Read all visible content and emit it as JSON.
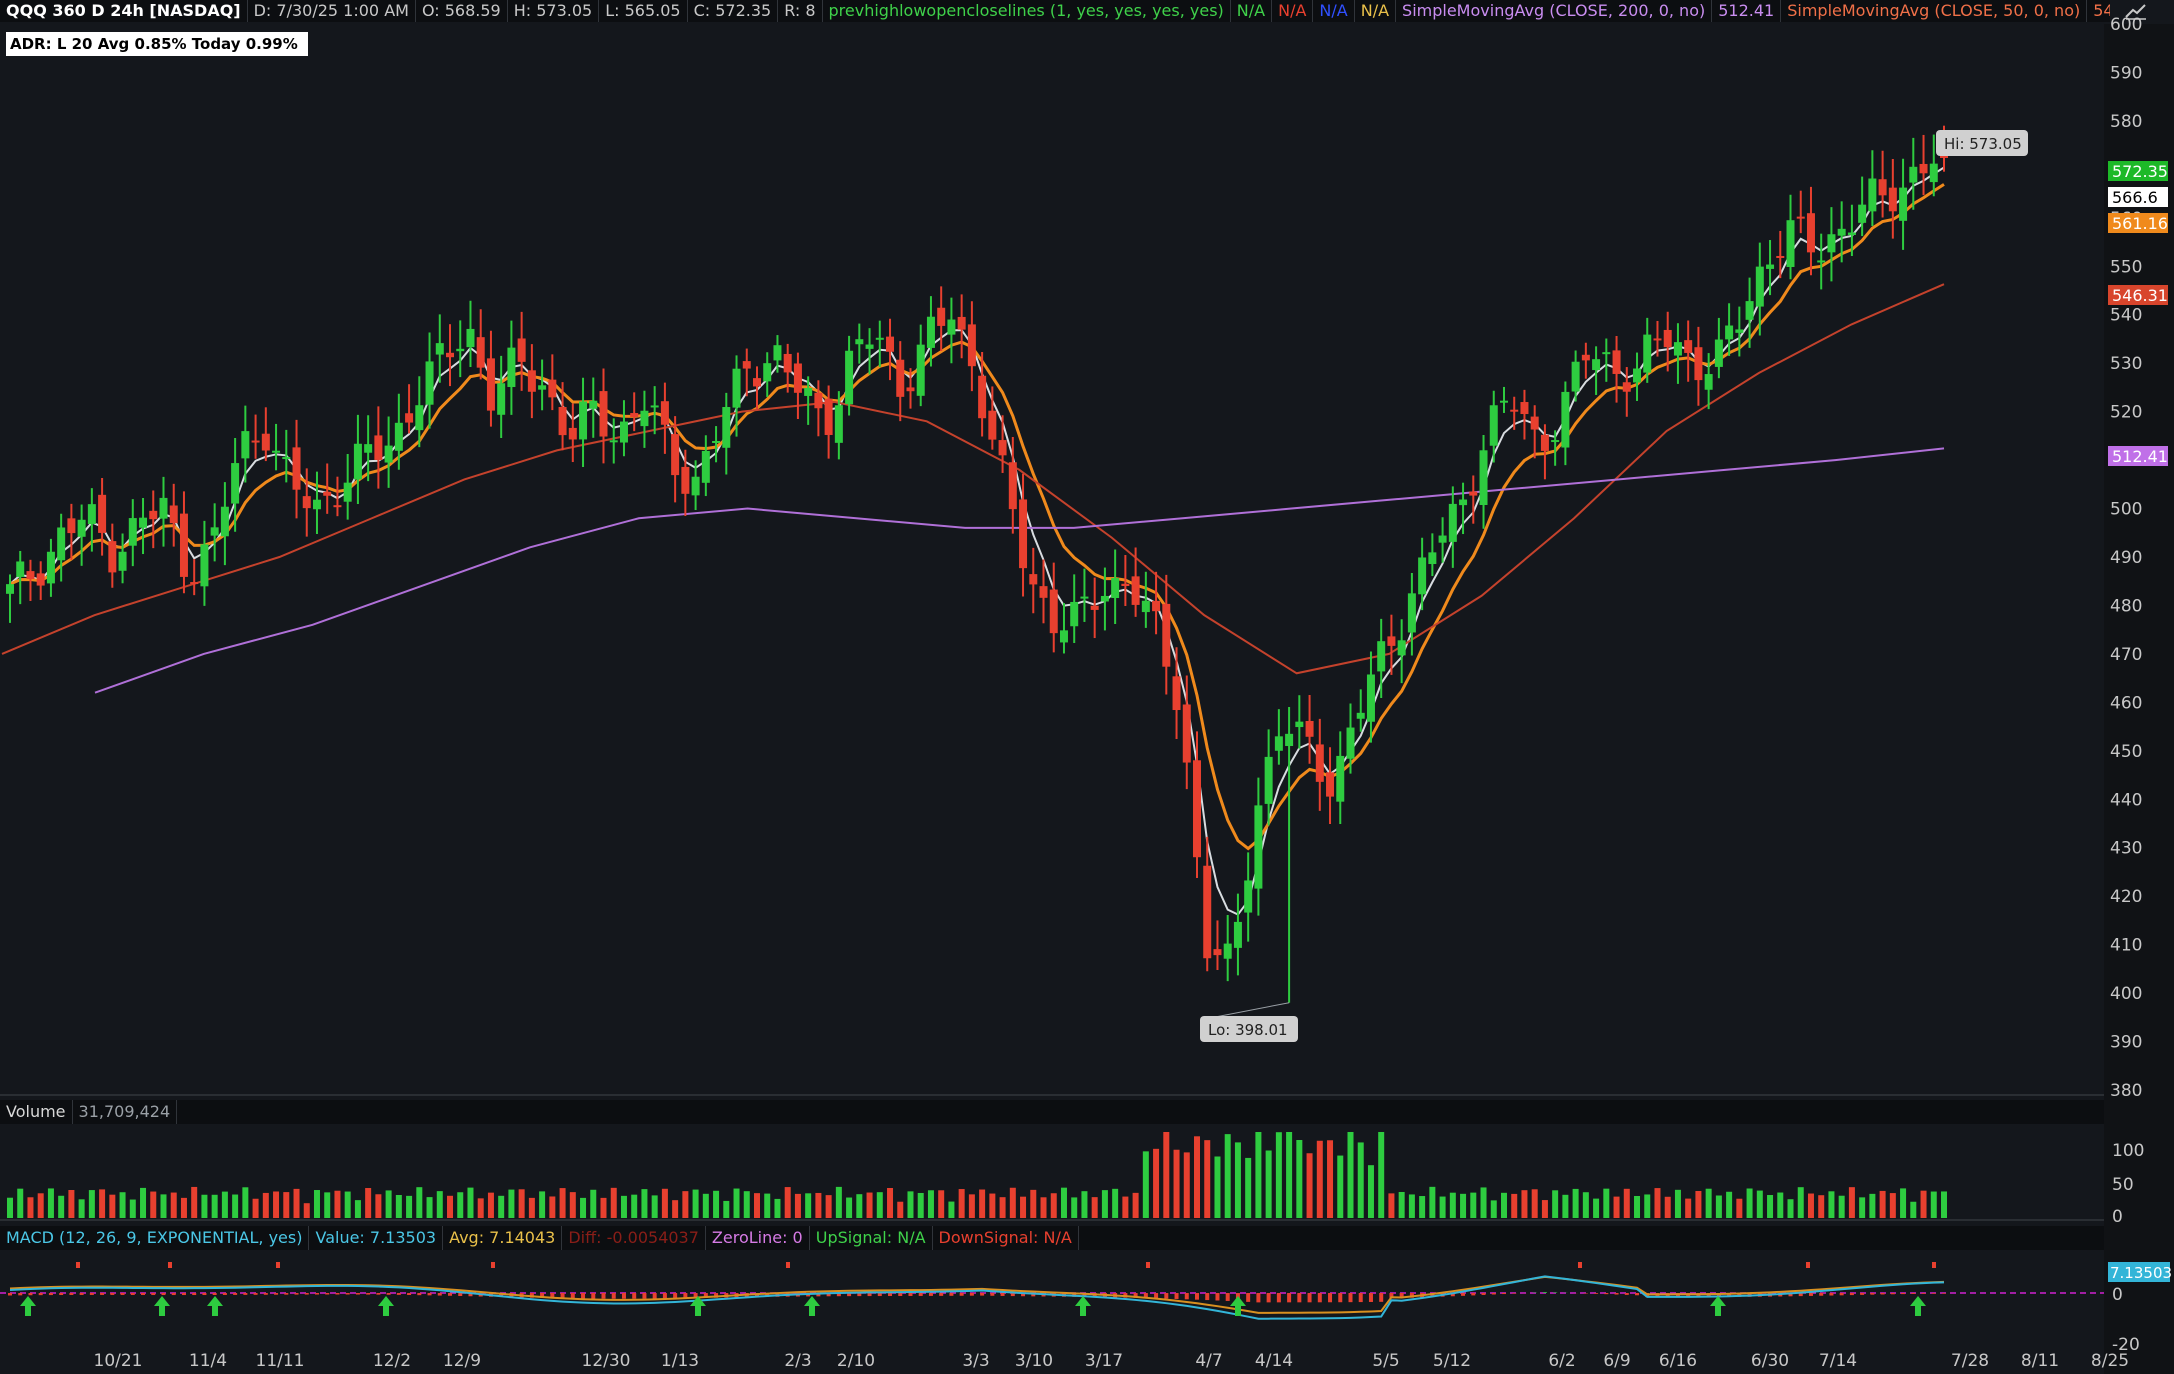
{
  "header": {
    "symbol": "QQQ 360 D 24h [NASDAQ]",
    "date": "D: 7/30/25 1:00 AM",
    "open": "O: 568.59",
    "high": "H: 573.05",
    "low": "L: 565.05",
    "close": "C: 572.35",
    "range": "R: 8",
    "study1": "prevhighlowopencloselines (1, yes, yes, yes, yes)",
    "study1_v1": "N/A",
    "study1_v2": "N/A",
    "study1_v3": "N/A",
    "study1_v4": "N/A",
    "sma200_label": "SimpleMovingAvg (CLOSE, 200, 0, no)",
    "sma200_value": "512.41",
    "sma50_label": "SimpleMovingAvg (CLOSE, 50, 0, no)",
    "sma50_value": "546.31",
    "more": "..."
  },
  "adr_label": "ADR: L 20  Avg 0.85%  Today 0.99%",
  "volume_header": {
    "label": "Volume",
    "value": "31,709,424"
  },
  "macd_header": {
    "label": "MACD (12, 26, 9, EXPONENTIAL, yes)",
    "value": "Value: 7.13503",
    "avg": "Avg: 7.14043",
    "diff": "Diff: -0.0054037",
    "zero": "ZeroLine: 0",
    "up": "UpSignal: N/A",
    "down": "DownSignal: N/A"
  },
  "chart_data": {
    "type": "candlestick",
    "price_axis": {
      "min": 380,
      "max": 600,
      "ticks": [
        380,
        390,
        400,
        410,
        420,
        430,
        440,
        450,
        460,
        470,
        480,
        490,
        500,
        510,
        520,
        530,
        540,
        550,
        560,
        570,
        580,
        590,
        600
      ]
    },
    "volume_axis": {
      "ticks": [
        "0",
        "50",
        "100"
      ]
    },
    "macd_axis": {
      "ticks": [
        "0",
        "-20"
      ]
    },
    "x_tick_labels": [
      "10/21",
      "11/4",
      "11/11",
      "12/2",
      "12/9",
      "12/30",
      "1/13",
      "2/3",
      "2/10",
      "3/3",
      "3/10",
      "3/17",
      "4/7",
      "4/14",
      "5/5",
      "5/12",
      "6/2",
      "6/9",
      "6/16",
      "6/30",
      "7/14",
      "7/28",
      "8/11",
      "8/25"
    ],
    "price_path": [
      482,
      488,
      494,
      498,
      492,
      496,
      500,
      488,
      492,
      512,
      518,
      504,
      500,
      506,
      510,
      514,
      524,
      530,
      538,
      522,
      530,
      526,
      514,
      520,
      516,
      522,
      510,
      506,
      518,
      530,
      532,
      524,
      518,
      530,
      536,
      526,
      534,
      540,
      528,
      506,
      486,
      478,
      476,
      484,
      486,
      474,
      460,
      410,
      404,
      440,
      456,
      450,
      444,
      458,
      470,
      482,
      492,
      500,
      516,
      522,
      514,
      520,
      532,
      530,
      528,
      536,
      532,
      528,
      540,
      552,
      556,
      554,
      558,
      562,
      566,
      570,
      572.35
    ],
    "sma200_path": [
      462,
      470,
      476,
      484,
      492,
      498,
      500,
      498,
      496,
      496,
      498,
      500,
      502,
      504,
      506,
      508,
      510,
      512.41
    ],
    "sma50_path": [
      470,
      478,
      484,
      490,
      498,
      506,
      512,
      516,
      520,
      522,
      518,
      508,
      494,
      478,
      466,
      470,
      482,
      498,
      516,
      528,
      538,
      546.31
    ],
    "markers": {
      "hi": {
        "label": "Hi: 573.05",
        "value": 573.05
      },
      "lo": {
        "label": "Lo: 398.01",
        "value": 398.01
      }
    },
    "price_labels": [
      {
        "text": "572.35",
        "color": "#1db928"
      },
      {
        "text": "566.6",
        "color": "#ffffff"
      },
      {
        "text": "561.16",
        "color": "#f08a1c"
      },
      {
        "text": "546.31",
        "color": "#d8452c"
      },
      {
        "text": "512.41",
        "color": "#c070e8"
      }
    ],
    "colors": {
      "up": "#2ecc40",
      "down": "#e8402f",
      "ema_fast": "#d8dce0",
      "ema_mid": "#f08a1c",
      "sma50": "#c4422c",
      "sma200": "#b070d8",
      "macd": "#33b5d8",
      "macd_avg": "#d89020"
    }
  }
}
